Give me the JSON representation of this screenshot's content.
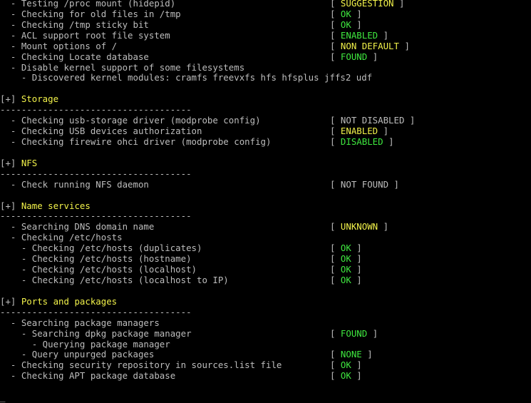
{
  "colors": {
    "text": "#bdbdbd",
    "yellow": "#f2f24a",
    "green": "#3fe83f",
    "background": "#000000"
  },
  "lines": [
    {
      "text": "  - Testing /proc mount (hidepid)",
      "status": {
        "label": "SUGGESTION",
        "color": "yellow"
      }
    },
    {
      "text": "  - Checking for old files in /tmp",
      "status": {
        "label": "OK",
        "color": "green"
      }
    },
    {
      "text": "  - Checking /tmp sticky bit",
      "status": {
        "label": "OK",
        "color": "green"
      }
    },
    {
      "text": "  - ACL support root file system",
      "status": {
        "label": "ENABLED",
        "color": "green"
      }
    },
    {
      "text": "  - Mount options of /",
      "status": {
        "label": "NON DEFAULT",
        "color": "yellow"
      }
    },
    {
      "text": "  - Checking Locate database",
      "status": {
        "label": "FOUND",
        "color": "green"
      }
    },
    {
      "text": "  - Disable kernel support of some filesystems"
    },
    {
      "text": "    - Discovered kernel modules: cramfs freevxfs hfs hfsplus jffs2 udf"
    },
    {
      "text": ""
    },
    {
      "section": "Storage"
    },
    {
      "text": "------------------------------------"
    },
    {
      "text": "  - Checking usb-storage driver (modprobe config)",
      "status": {
        "label": "NOT DISABLED",
        "color": "white"
      }
    },
    {
      "text": "  - Checking USB devices authorization",
      "status": {
        "label": "ENABLED",
        "color": "yellow"
      }
    },
    {
      "text": "  - Checking firewire ohci driver (modprobe config)",
      "status": {
        "label": "DISABLED",
        "color": "green"
      }
    },
    {
      "text": ""
    },
    {
      "section": "NFS"
    },
    {
      "text": "------------------------------------"
    },
    {
      "text": "  - Check running NFS daemon",
      "status": {
        "label": "NOT FOUND",
        "color": "white"
      }
    },
    {
      "text": ""
    },
    {
      "section": "Name services"
    },
    {
      "text": "------------------------------------"
    },
    {
      "text": "  - Searching DNS domain name",
      "status": {
        "label": "UNKNOWN",
        "color": "yellow"
      }
    },
    {
      "text": "  - Checking /etc/hosts"
    },
    {
      "text": "    - Checking /etc/hosts (duplicates)",
      "status": {
        "label": "OK",
        "color": "green"
      }
    },
    {
      "text": "    - Checking /etc/hosts (hostname)",
      "status": {
        "label": "OK",
        "color": "green"
      }
    },
    {
      "text": "    - Checking /etc/hosts (localhost)",
      "status": {
        "label": "OK",
        "color": "green"
      }
    },
    {
      "text": "    - Checking /etc/hosts (localhost to IP)",
      "status": {
        "label": "OK",
        "color": "green"
      }
    },
    {
      "text": ""
    },
    {
      "section": "Ports and packages"
    },
    {
      "text": "------------------------------------"
    },
    {
      "text": "  - Searching package managers"
    },
    {
      "text": "    - Searching dpkg package manager",
      "status": {
        "label": "FOUND",
        "color": "green"
      }
    },
    {
      "text": "      - Querying package manager"
    },
    {
      "text": "    - Query unpurged packages",
      "status": {
        "label": "NONE",
        "color": "green"
      }
    },
    {
      "text": "  - Checking security repository in sources.list file",
      "status": {
        "label": "OK",
        "color": "green"
      }
    },
    {
      "text": "  - Checking APT package database",
      "status": {
        "label": "OK",
        "color": "green"
      }
    },
    {
      "text": ""
    }
  ],
  "section_prefix": "[+] ",
  "cursor": "_"
}
